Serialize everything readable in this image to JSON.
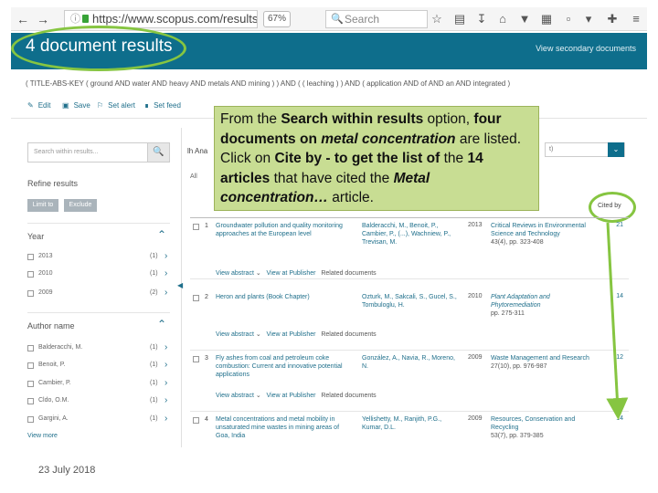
{
  "browser": {
    "url": "https://www.scopus.com/results/r",
    "zoom": "67%",
    "search_placeholder": "Search"
  },
  "header": {
    "title": "4 document results",
    "secondary_link": "View secondary documents"
  },
  "query": "( TITLE-ABS-KEY ( ground AND water AND heavy AND metals AND mining ) ) AND ( ( leaching ) ) AND ( application AND of AND an AND integrated )",
  "actions": [
    "Edit",
    "Save",
    "Set alert",
    "Set feed"
  ],
  "sidebar": {
    "search_placeholder": "Search within results...",
    "refine_title": "Refine results",
    "limit_label": "Limit to",
    "exclude_label": "Exclude",
    "year_heading": "Year",
    "years": [
      {
        "label": "2013",
        "count": "(1)"
      },
      {
        "label": "2010",
        "count": "(1)"
      },
      {
        "label": "2009",
        "count": "(2)"
      }
    ],
    "author_heading": "Author name",
    "authors": [
      {
        "label": "Balderacchi, M.",
        "count": "(1)"
      },
      {
        "label": "Benoit, P.",
        "count": "(1)"
      },
      {
        "label": "Cambier, P.",
        "count": "(1)"
      },
      {
        "label": "Cldo, O.M.",
        "count": "(1)"
      },
      {
        "label": "Gargini, A.",
        "count": "(1)"
      }
    ],
    "view_more": "View more"
  },
  "table": {
    "tabs_stub": "lh  Ana",
    "all_stub": "All",
    "cited_by_header": "Cited by",
    "sort_label": "t)"
  },
  "results": [
    {
      "num": "1",
      "title": "Groundwater pollution and quality monitoring approaches at the European level",
      "authors": "Balderacchi, M., Benoit, P., Cambier, P., (...), Wachniew, P., Trevisan, M.",
      "year": "2013",
      "source": "Critical Reviews in Environmental Science and Technology",
      "source_detail": "43(4), pp. 323-408",
      "cited": "21",
      "links": [
        "View abstract",
        "View at Publisher",
        "Related documents"
      ]
    },
    {
      "num": "2",
      "title": "Heron and plants (Book Chapter)",
      "authors": "Ozturk, M., Sakcali, S., Gucel, S., Tombuloglu, H.",
      "year": "2010",
      "source": "Plant Adaptation and Phytoremediation",
      "source_detail": "pp. 275-311",
      "cited": "14",
      "links": [
        "View abstract",
        "View at Publisher",
        "Related documents"
      ]
    },
    {
      "num": "3",
      "title": "Fly ashes from coal and petroleum coke combustion: Current and innovative potential applications",
      "authors": "González, A., Navia, R., Moreno, N.",
      "year": "2009",
      "source": "Waste Management and Research",
      "source_detail": "27(10), pp. 976-987",
      "cited": "12",
      "links": [
        "View abstract",
        "View at Publisher",
        "Related documents"
      ]
    },
    {
      "num": "4",
      "title": "Metal concentrations and metal mobility in unsaturated mine wastes in mining areas of Goa, India",
      "authors": "Yellishetty, M., Ranjith, P.G., Kumar, D.L.",
      "year": "2009",
      "source": "Resources, Conservation and Recycling",
      "source_detail": "53(7), pp. 379-385",
      "cited": "14",
      "links": []
    }
  ],
  "callout": {
    "p1": "From the ",
    "p2": "Search within results",
    "p3": " option, ",
    "p4": "four documents on ",
    "p5": "metal concentration",
    "p6": " are listed.  Click on ",
    "p7": "Cite by - to get the list of",
    "p8": " the ",
    "p9": "14 articles",
    "p10": " that have cited the ",
    "p11": "Metal concentration…",
    "p12": " article."
  },
  "footer_date": "23 July 2018",
  "colors": {
    "header_bg": "#0e6e8c",
    "link": "#1f6f8b",
    "highlight_green": "#86c541",
    "callout_bg": "#c8dd93"
  },
  "icons": [
    "back-arrow-icon",
    "forward-arrow-icon",
    "info-icon",
    "lock-icon",
    "search-icon",
    "star-icon",
    "reading-list-icon",
    "download-icon",
    "home-icon",
    "pocket-icon",
    "screenshot-icon",
    "menu-icon",
    "edit-icon",
    "save-icon",
    "alert-icon",
    "feed-icon"
  ]
}
